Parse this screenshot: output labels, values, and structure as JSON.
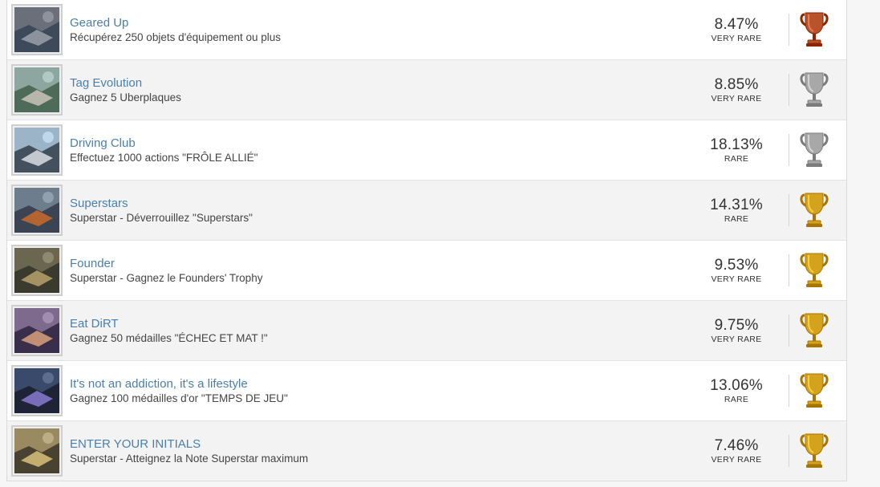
{
  "achievements": [
    {
      "title": "Geared Up",
      "description": "Récupérez 250 objets d'équipement ou plus",
      "percent": "8.47%",
      "rarity": "VERY RARE",
      "trophy": "bronze-trophy",
      "colors": [
        "#6b6f7a",
        "#3d4a5a",
        "#9aa0a8"
      ]
    },
    {
      "title": "Tag Evolution",
      "description": "Gagnez 5 Uberplaques",
      "percent": "8.85%",
      "rarity": "VERY RARE",
      "trophy": "silver-trophy",
      "colors": [
        "#8ea6a0",
        "#4e6a58",
        "#c9c4b8"
      ]
    },
    {
      "title": "Driving Club",
      "description": "Effectuez 1000 actions \"FRÔLE ALLIÉ\"",
      "percent": "18.13%",
      "rarity": "RARE",
      "trophy": "silver-trophy",
      "colors": [
        "#9bb4c8",
        "#43505e",
        "#d8dde2"
      ]
    },
    {
      "title": "Superstars",
      "description": "Superstar - Déverrouillez \"Superstars\"",
      "percent": "14.31%",
      "rarity": "RARE",
      "trophy": "gold-trophy",
      "colors": [
        "#6d7d8c",
        "#3a4452",
        "#c96a2a"
      ]
    },
    {
      "title": "Founder",
      "description": "Superstar - Gagnez le Founders' Trophy",
      "percent": "9.53%",
      "rarity": "VERY RARE",
      "trophy": "gold-trophy",
      "colors": [
        "#6a6650",
        "#3b3a2e",
        "#b8a16a"
      ]
    },
    {
      "title": "Eat DiRT",
      "description": "Gagnez 50 médailles \"ÉCHEC ET MAT !\"",
      "percent": "9.75%",
      "rarity": "VERY RARE",
      "trophy": "gold-trophy",
      "colors": [
        "#7d6a8c",
        "#3a2f4a",
        "#d9a07a"
      ]
    },
    {
      "title": "It's not an addiction, it's a lifestyle",
      "description": "Gagnez 100 médailles d'or \"TEMPS DE JEU\"",
      "percent": "13.06%",
      "rarity": "RARE",
      "trophy": "gold-trophy",
      "colors": [
        "#3a4a6a",
        "#1e2436",
        "#8a7ad0"
      ]
    },
    {
      "title": "ENTER YOUR INITIALS",
      "description": "Superstar - Atteignez la Note Superstar maximum",
      "percent": "7.46%",
      "rarity": "VERY RARE",
      "trophy": "gold-trophy",
      "colors": [
        "#9a8a62",
        "#4a4230",
        "#d8c07a"
      ]
    }
  ],
  "trophy_colors": {
    "bronze": "#b8532c",
    "silver": "#a8a8a8",
    "gold": "#d4a21c"
  }
}
